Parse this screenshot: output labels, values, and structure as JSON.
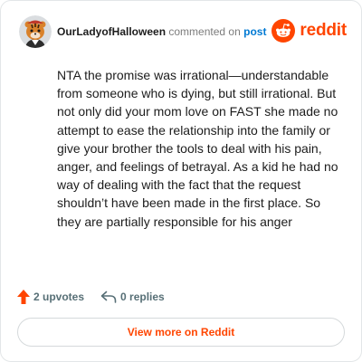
{
  "comment": {
    "author": "OurLadyofHalloween",
    "action_text": "commented on",
    "target_link": "post",
    "body": "NTA the promise was irrational—understandable from someone who is dying, but still irrational. But not only did your mom love on FAST she made no attempt to ease the relationship into the family or give your brother the tools to deal with his pain, anger, and feelings of betrayal. As a kid he had no way of dealing with the fact that the request shouldn’t have been made in the first place. So they are partially responsible for his anger"
  },
  "brand": {
    "wordmark": "reddit",
    "icon": "reddit-snoo-icon",
    "color": "#ff4500"
  },
  "actions": {
    "upvotes_label": "2 upvotes",
    "upvote_icon": "upvote-arrow-icon",
    "upvote_color": "#ff4500",
    "replies_label": "0 replies",
    "reply_icon": "reply-arrow-icon"
  },
  "footer": {
    "view_button_label": "View more on Reddit"
  },
  "colors": {
    "accent": "#ff4500",
    "link": "#0079d3",
    "muted_text": "#576f76"
  }
}
